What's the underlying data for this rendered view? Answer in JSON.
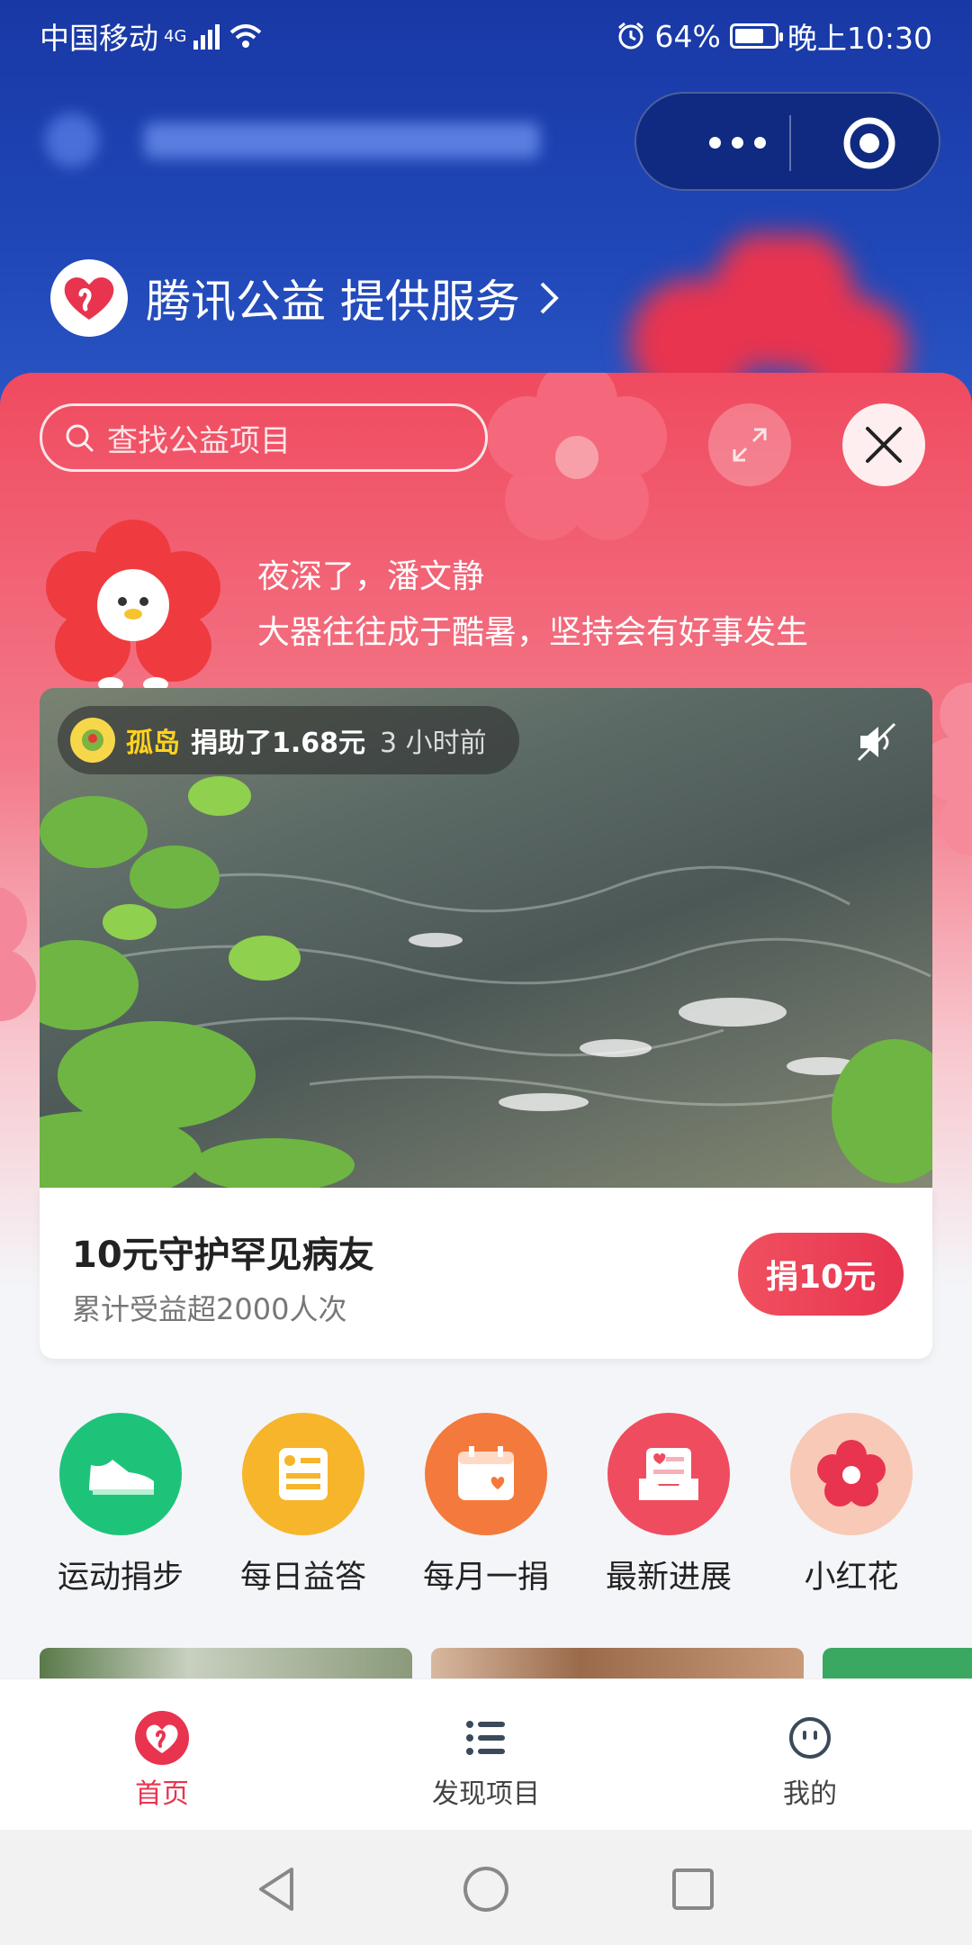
{
  "status": {
    "carrier": "中国移动",
    "network": "4G",
    "battery": "64%",
    "time": "晚上10:30"
  },
  "header": {
    "provider": "腾讯公益 提供服务"
  },
  "search": {
    "placeholder": "查找公益项目"
  },
  "greeting": {
    "line1": "夜深了，潘文静",
    "line2": "大器往往成于酷暑，坚持会有好事发生"
  },
  "video": {
    "donor_name": "孤岛",
    "donation_text": "捐助了1.68元",
    "time_ago": "3 小时前"
  },
  "project": {
    "title": "10元守护罕见病友",
    "subtitle": "累计受益超2000人次",
    "donate_label": "捐10元"
  },
  "features": [
    {
      "label": "运动捐步",
      "icon": "sneaker-icon",
      "color": "#1ec37a"
    },
    {
      "label": "每日益答",
      "icon": "quiz-card-icon",
      "color": "#f6b52a"
    },
    {
      "label": "每月一捐",
      "icon": "calendar-heart-icon",
      "color": "#f37a3c"
    },
    {
      "label": "最新进展",
      "icon": "inbox-heart-icon",
      "color": "#ef4c60"
    },
    {
      "label": "小红花",
      "icon": "red-flower-icon",
      "color": "#f8c9b6"
    }
  ],
  "tabs": [
    {
      "label": "首页",
      "icon": "home-heart-icon",
      "active": true
    },
    {
      "label": "发现项目",
      "icon": "list-icon",
      "active": false
    },
    {
      "label": "我的",
      "icon": "smiley-icon",
      "active": false
    }
  ],
  "colors": {
    "accent": "#e8344f",
    "header_blue": "#1838a5"
  }
}
